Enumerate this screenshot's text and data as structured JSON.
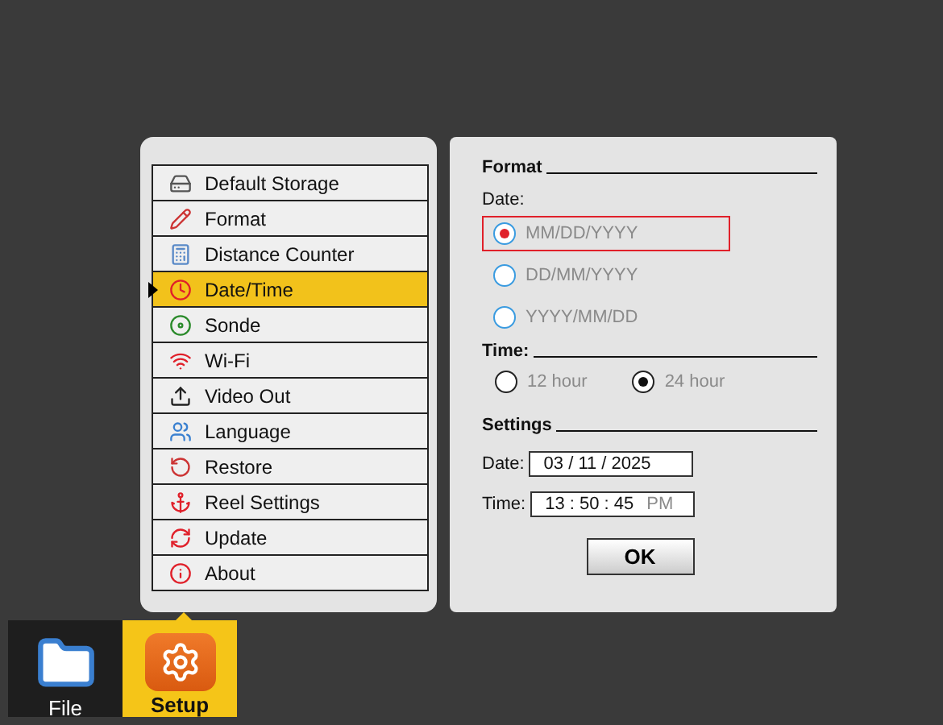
{
  "menu": {
    "items": [
      {
        "label": "Default Storage",
        "selected": false
      },
      {
        "label": "Format",
        "selected": false
      },
      {
        "label": "Distance Counter",
        "selected": false
      },
      {
        "label": "Date/Time",
        "selected": true
      },
      {
        "label": "Sonde",
        "selected": false
      },
      {
        "label": "Wi-Fi",
        "selected": false
      },
      {
        "label": "Video Out",
        "selected": false
      },
      {
        "label": "Language",
        "selected": false
      },
      {
        "label": "Restore",
        "selected": false
      },
      {
        "label": "Reel Settings",
        "selected": false
      },
      {
        "label": "Update",
        "selected": false
      },
      {
        "label": "About",
        "selected": false
      }
    ]
  },
  "format": {
    "title": "Format",
    "date_label": "Date:",
    "date_options": [
      {
        "label": "MM/DD/YYYY",
        "selected": true,
        "focused": true
      },
      {
        "label": "DD/MM/YYYY",
        "selected": false,
        "focused": false
      },
      {
        "label": "YYYY/MM/DD",
        "selected": false,
        "focused": false
      }
    ],
    "time_label": "Time:",
    "time_options": [
      {
        "label": "12 hour",
        "selected": false
      },
      {
        "label": "24 hour",
        "selected": true
      }
    ]
  },
  "settings": {
    "title": "Settings",
    "date_label": "Date:",
    "date_value": "03 / 11 / 2025",
    "time_label": "Time:",
    "time_value": "13 : 50 : 45",
    "time_suffix": "PM"
  },
  "ok_button": "OK",
  "taskbar": [
    {
      "label": "File",
      "selected": false
    },
    {
      "label": "Setup",
      "selected": true
    }
  ]
}
